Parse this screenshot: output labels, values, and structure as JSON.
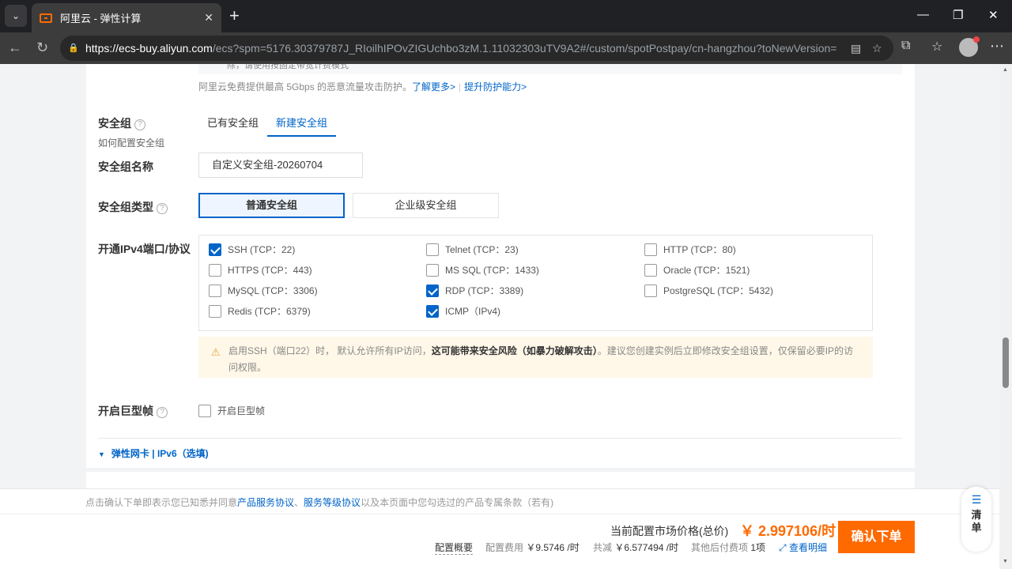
{
  "browser": {
    "tab_title": "阿里云 - 弹性计算",
    "url_host": "https://ecs-buy.aliyun.com",
    "url_rest": "/ecs?spm=5176.30379787J_RIoilhIPOvZIGUchbo3zM.1.11032303uTV9A2#/custom/spotPostpay/cn-hangzhou?toNewVersion=..."
  },
  "ddos": {
    "top_text": "除，请使用按固定带宽计费模式",
    "note": "阿里云免费提供最高 5Gbps 的恶意流量攻击防护。",
    "learn_more": "了解更多>",
    "upgrade": "提升防护能力>"
  },
  "security_group": {
    "label": "安全组",
    "sublabel": "如何配置安全组",
    "tabs": [
      "已有安全组",
      "新建安全组"
    ],
    "name_label": "安全组名称",
    "name_value": "自定义安全组-20260704",
    "type_label": "安全组类型",
    "types": [
      "普通安全组",
      "企业级安全组"
    ],
    "ports_label": "开通IPv4端口/协议",
    "ports": [
      {
        "label": "SSH (TCP：22)",
        "checked": true
      },
      {
        "label": "Telnet (TCP：23)",
        "checked": false
      },
      {
        "label": "HTTP (TCP：80)",
        "checked": false
      },
      {
        "label": "HTTPS (TCP：443)",
        "checked": false
      },
      {
        "label": "MS SQL (TCP：1433)",
        "checked": false
      },
      {
        "label": "Oracle (TCP：1521)",
        "checked": false
      },
      {
        "label": "MySQL (TCP：3306)",
        "checked": false
      },
      {
        "label": "RDP (TCP：3389)",
        "checked": true
      },
      {
        "label": "PostgreSQL (TCP：5432)",
        "checked": false
      },
      {
        "label": "Redis (TCP：6379)",
        "checked": false
      },
      {
        "label": "ICMP（IPv4)",
        "checked": true
      }
    ],
    "warning_pre": "启用SSH（端口22）时， 默认允许所有IP访问，",
    "warning_bold": "这可能带来安全风险（如暴力破解攻击）",
    "warning_post": "。建议您创建实例后立即修改安全组设置，仅保留必要IP的访问权限。"
  },
  "jumbo": {
    "label": "开启巨型帧",
    "checkbox_label": "开启巨型帧"
  },
  "eni": {
    "label": "弹性网卡 | IPv6（选填)"
  },
  "agreement": {
    "pre": "点击确认下单即表示您已知悉并同意",
    "link1": "产品服务协议",
    "sep": "、",
    "link2": "服务等级协议",
    "post": "以及本页面中您勾选过的产品专属条款（若有)"
  },
  "footer": {
    "price_label": "当前配置市场价格(总价)",
    "price": "￥ 2.997106/时",
    "order_button": "确认下单",
    "config_summary": "配置概要",
    "config_fee_label": "配置费用",
    "config_fee": "￥9.5746 /时",
    "discount_label": "共减",
    "discount": "￥6.577494 /时",
    "other_label": "其他后付费项",
    "other_count": "1项",
    "details": "查看明细"
  },
  "side_widget": {
    "label": "清单"
  }
}
